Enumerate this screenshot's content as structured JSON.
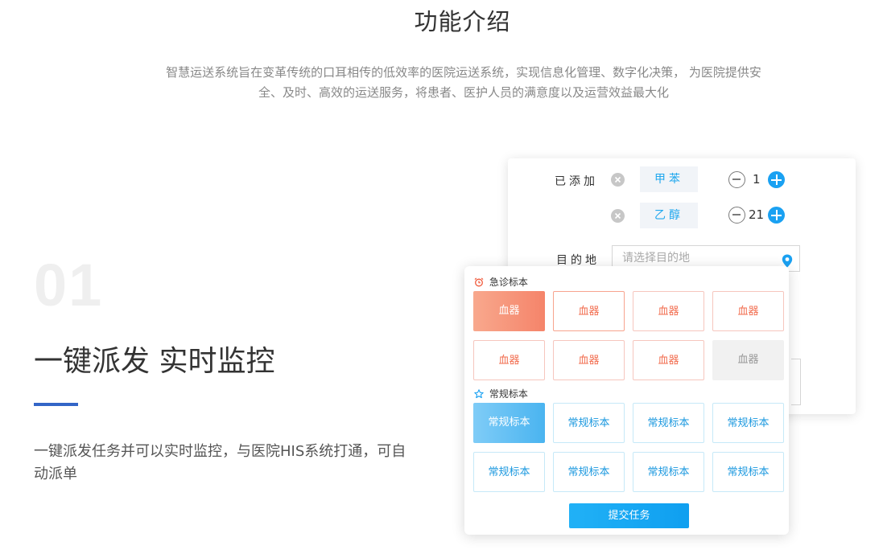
{
  "header": {
    "title": "功能介绍",
    "intro_line1": "智慧运送系统旨在变革传统的口耳相传的低效率的医院运送系统，实现信息化管理、数字化决策， 为医院提供安",
    "intro_line2": "全、及时、高效的运送服务，将患者、医护人员的满意度以及运营效益最大化"
  },
  "feature": {
    "number": "01",
    "title": "一键派发 实时监控",
    "desc_line1": "一键派发任务并可以实时监控，与医院HIS系统打通，可自",
    "desc_line2": "动派单"
  },
  "form": {
    "added_label": "已添加",
    "items": [
      {
        "name": "甲苯",
        "qty": "1"
      },
      {
        "name": "乙醇",
        "qty": "21"
      }
    ],
    "destination_label": "目的地",
    "destination_placeholder": "请选择目的地"
  },
  "urgent": {
    "title": "急诊标本",
    "tiles": [
      "血器",
      "血器",
      "血器",
      "血器",
      "血器",
      "血器",
      "血器",
      "血器"
    ]
  },
  "regular": {
    "title": "常规标本",
    "tiles": [
      "常规标本",
      "常规标本",
      "常规标本",
      "常规标本",
      "常规标本",
      "常规标本",
      "常规标本",
      "常规标本"
    ]
  },
  "submit_label": "提交任务",
  "icons": {
    "remove": "close-circle-icon",
    "minus": "minus-circle-icon",
    "plus": "plus-circle-icon",
    "location": "map-pin-icon",
    "alarm": "alarm-clock-icon",
    "star": "star-icon"
  },
  "colors": {
    "accent_blue": "#1aa1f2",
    "urgent_red": "#f26d4f",
    "underline": "#3365c7"
  }
}
